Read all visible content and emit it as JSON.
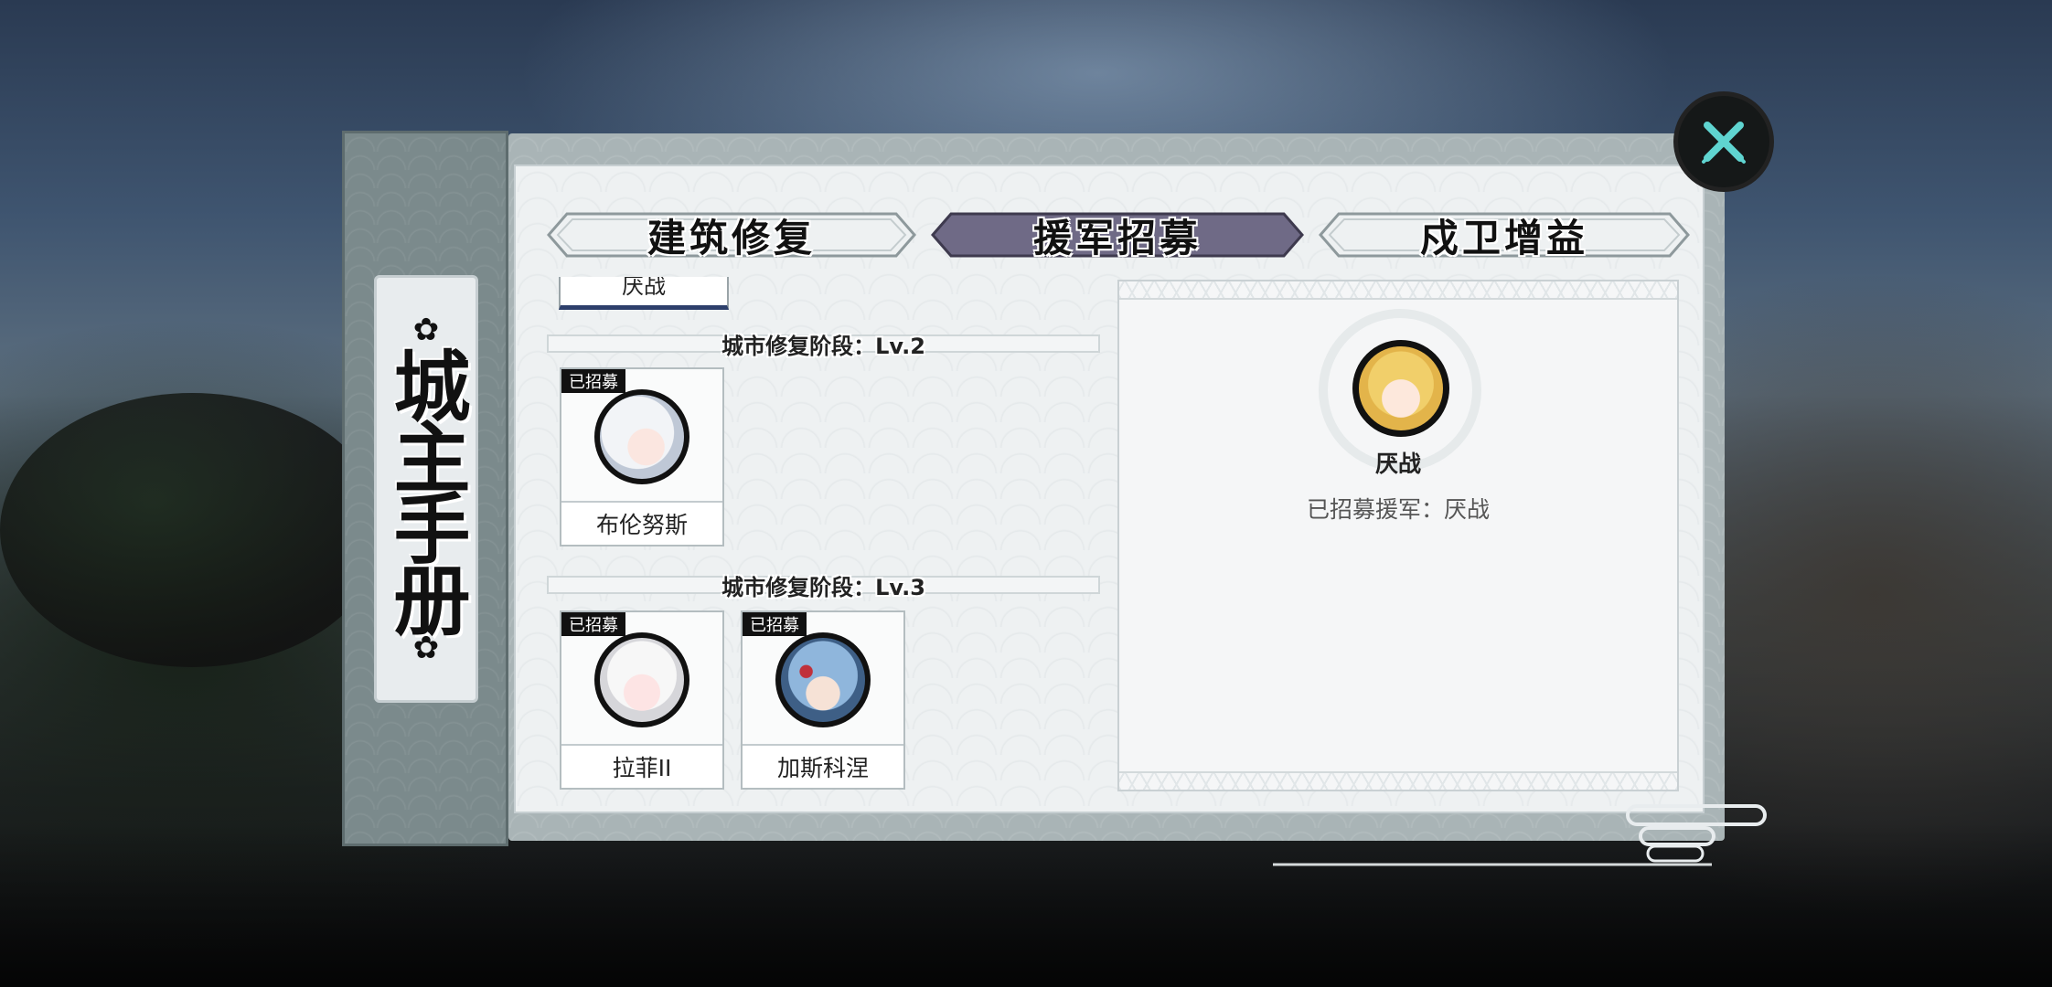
{
  "sidebar": {
    "title": "城主手册",
    "flower_glyph": "✿"
  },
  "tabs": [
    {
      "label": "建筑修复",
      "active": false
    },
    {
      "label": "援军招募",
      "active": true
    },
    {
      "label": "戍卫增益",
      "active": false
    }
  ],
  "list": {
    "peek_name": "厌战",
    "stages": [
      {
        "label": "城市修复阶段：Lv.2",
        "characters": [
          {
            "name": "布伦努斯",
            "badge": "已招募",
            "portrait": "white-hair-portrait"
          }
        ]
      },
      {
        "label": "城市修复阶段：Lv.3",
        "characters": [
          {
            "name": "拉菲II",
            "badge": "已招募",
            "portrait": "white-twintail-portrait"
          },
          {
            "name": "加斯科涅",
            "badge": "已招募",
            "portrait": "blue-hair-portrait"
          }
        ]
      }
    ]
  },
  "recruited": {
    "name": "厌战",
    "status": "已招募援军：厌战"
  },
  "colors": {
    "active_tab": "#6f6a86",
    "inactive_tab": "#eef1f2",
    "close_icon": "#5fd4d0"
  }
}
